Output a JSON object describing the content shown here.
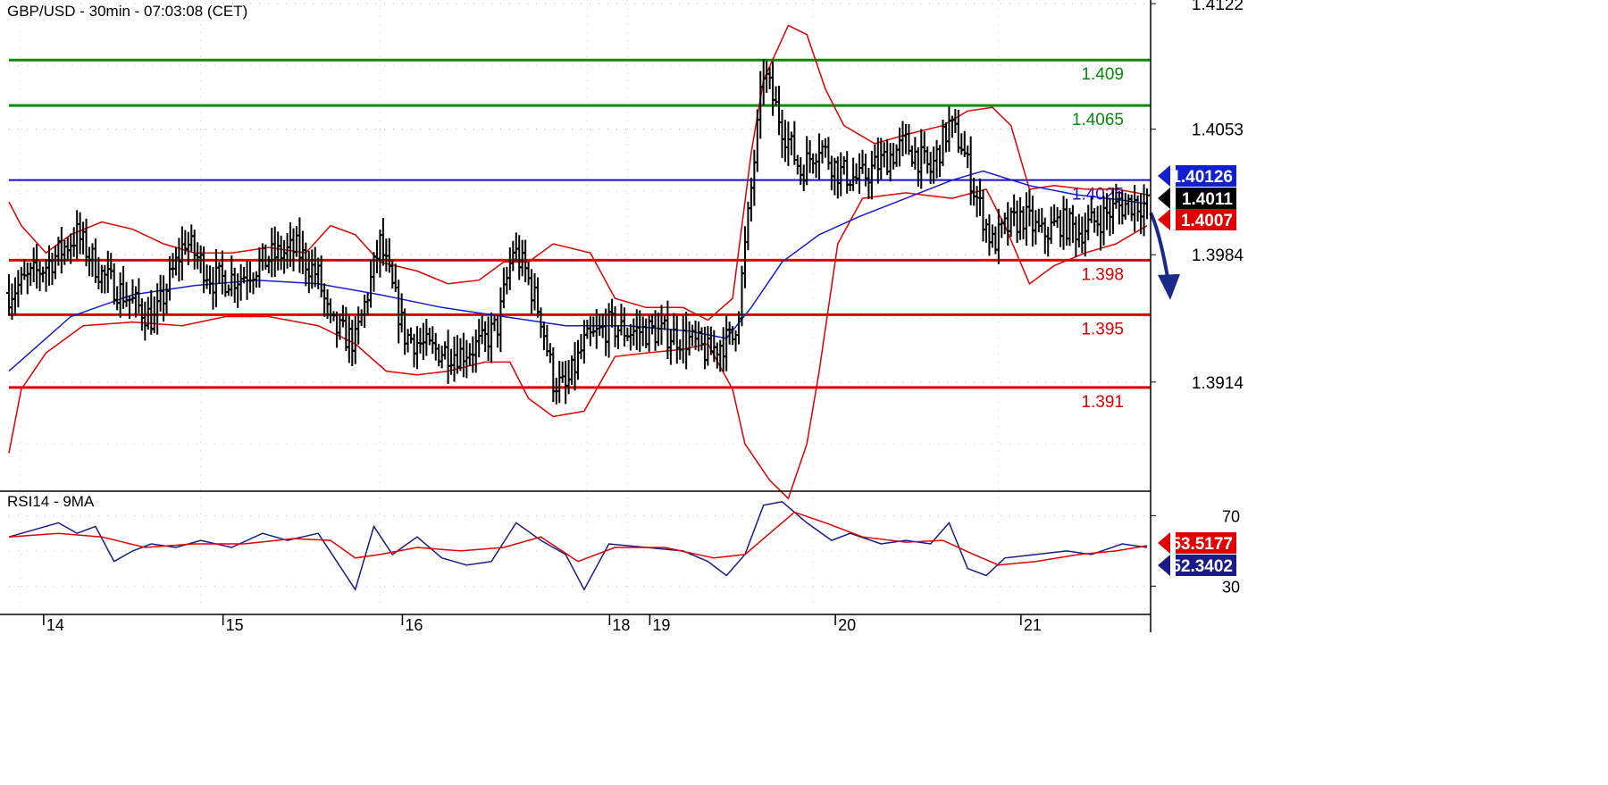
{
  "chart_data": [
    {
      "type": "candlestick",
      "title": "GBP/USD - 30min - 07:03:08 (CET)",
      "ylim": [
        1.3855,
        1.4124
      ],
      "y_ticks": [
        "1.4122",
        "1.4053",
        "1.3984",
        "1.3914"
      ],
      "x_ticks": [
        "14",
        "15",
        "16",
        "18",
        "19",
        "20",
        "21"
      ],
      "grid": true,
      "levels": [
        {
          "label": "1.409",
          "value": 1.4091,
          "color": "#0a8a0a"
        },
        {
          "label": "1.4065",
          "value": 1.4066,
          "color": "#0a8a0a"
        },
        {
          "label": "1.4025",
          "value": 1.4025,
          "color": "#1010c8"
        },
        {
          "label": "1.398",
          "value": 1.3981,
          "color": "#e00000"
        },
        {
          "label": "1.395",
          "value": 1.3951,
          "color": "#e00000"
        },
        {
          "label": "1.391",
          "value": 1.3911,
          "color": "#e00000"
        }
      ],
      "price_badges": [
        {
          "label": "1.40126",
          "value": 1.40126,
          "color": "#1020d0"
        },
        {
          "label": "1.4011",
          "value": 1.4011,
          "color": "#000000"
        },
        {
          "label": "1.4007",
          "value": 1.4007,
          "color": "#e00000"
        }
      ],
      "close_path": [
        [
          0,
          1.3963
        ],
        [
          12,
          1.3978
        ],
        [
          22,
          1.3995
        ],
        [
          30,
          1.3973
        ],
        [
          40,
          1.3958
        ],
        [
          47,
          1.3948
        ],
        [
          57,
          1.3992
        ],
        [
          66,
          1.397
        ],
        [
          75,
          1.3972
        ],
        [
          85,
          1.3983
        ],
        [
          93,
          1.3987
        ],
        [
          100,
          1.3972
        ],
        [
          104,
          1.3945
        ],
        [
          112,
          1.3936
        ],
        [
          120,
          1.399
        ],
        [
          128,
          1.394
        ],
        [
          136,
          1.3932
        ],
        [
          146,
          1.393
        ],
        [
          153,
          1.3935
        ],
        [
          158,
          1.3945
        ],
        [
          163,
          1.3987
        ],
        [
          167,
          1.3975
        ],
        [
          172,
          1.395
        ],
        [
          176,
          1.3915
        ],
        [
          180,
          1.391
        ],
        [
          186,
          1.3935
        ],
        [
          194,
          1.3945
        ],
        [
          200,
          1.3942
        ],
        [
          208,
          1.3942
        ],
        [
          214,
          1.394
        ],
        [
          220,
          1.3937
        ],
        [
          226,
          1.393
        ],
        [
          230,
          1.3935
        ],
        [
          234,
          1.3938
        ],
        [
          236,
          1.3955
        ],
        [
          240,
          1.402
        ],
        [
          244,
          1.4085
        ],
        [
          250,
          1.4055
        ],
        [
          256,
          1.403
        ],
        [
          262,
          1.4045
        ],
        [
          268,
          1.403
        ],
        [
          275,
          1.4025
        ],
        [
          282,
          1.4035
        ],
        [
          290,
          1.4045
        ],
        [
          298,
          1.403
        ],
        [
          304,
          1.4055
        ],
        [
          308,
          1.4045
        ],
        [
          312,
          1.402
        ],
        [
          318,
          1.399
        ],
        [
          322,
          1.3998
        ],
        [
          328,
          1.4005
        ],
        [
          334,
          1.3995
        ],
        [
          340,
          1.4002
        ],
        [
          346,
          1.3997
        ],
        [
          352,
          1.4003
        ],
        [
          358,
          1.401
        ],
        [
          364,
          1.4013
        ],
        [
          368,
          1.4011
        ]
      ],
      "sma_path": [
        [
          0,
          1.392
        ],
        [
          20,
          1.395
        ],
        [
          40,
          1.3962
        ],
        [
          60,
          1.3967
        ],
        [
          80,
          1.397
        ],
        [
          100,
          1.3968
        ],
        [
          120,
          1.3962
        ],
        [
          140,
          1.3955
        ],
        [
          160,
          1.395
        ],
        [
          180,
          1.3945
        ],
        [
          200,
          1.3945
        ],
        [
          220,
          1.3942
        ],
        [
          232,
          1.3938
        ],
        [
          240,
          1.3955
        ],
        [
          250,
          1.398
        ],
        [
          262,
          1.3995
        ],
        [
          275,
          1.4005
        ],
        [
          290,
          1.4015
        ],
        [
          305,
          1.4025
        ],
        [
          315,
          1.403
        ],
        [
          330,
          1.4022
        ],
        [
          345,
          1.4017
        ],
        [
          360,
          1.4014
        ],
        [
          368,
          1.4012
        ]
      ],
      "band_upper": [
        [
          0,
          1.4013
        ],
        [
          4,
          1.4
        ],
        [
          12,
          1.3985
        ],
        [
          20,
          1.3995
        ],
        [
          30,
          1.4002
        ],
        [
          40,
          1.3998
        ],
        [
          50,
          1.399
        ],
        [
          60,
          1.3985
        ],
        [
          72,
          1.3985
        ],
        [
          84,
          1.3988
        ],
        [
          96,
          1.3985
        ],
        [
          104,
          1.4
        ],
        [
          112,
          1.3995
        ],
        [
          120,
          1.398
        ],
        [
          132,
          1.3975
        ],
        [
          142,
          1.3968
        ],
        [
          152,
          1.397
        ],
        [
          160,
          1.398
        ],
        [
          168,
          1.398
        ],
        [
          176,
          1.399
        ],
        [
          188,
          1.3985
        ],
        [
          196,
          1.396
        ],
        [
          206,
          1.3955
        ],
        [
          218,
          1.3955
        ],
        [
          226,
          1.3948
        ],
        [
          234,
          1.396
        ],
        [
          240,
          1.404
        ],
        [
          244,
          1.408
        ],
        [
          252,
          1.411
        ],
        [
          258,
          1.4105
        ],
        [
          264,
          1.4075
        ],
        [
          270,
          1.4055
        ],
        [
          280,
          1.4045
        ],
        [
          290,
          1.405
        ],
        [
          302,
          1.4055
        ],
        [
          310,
          1.4063
        ],
        [
          318,
          1.4065
        ],
        [
          324,
          1.4055
        ],
        [
          330,
          1.402
        ],
        [
          338,
          1.4022
        ],
        [
          348,
          1.402
        ],
        [
          358,
          1.402
        ],
        [
          368,
          1.4017
        ]
      ],
      "band_lower": [
        [
          0,
          1.3875
        ],
        [
          4,
          1.391
        ],
        [
          12,
          1.393
        ],
        [
          24,
          1.3945
        ],
        [
          40,
          1.3947
        ],
        [
          56,
          1.3945
        ],
        [
          70,
          1.395
        ],
        [
          84,
          1.395
        ],
        [
          100,
          1.3945
        ],
        [
          112,
          1.3935
        ],
        [
          122,
          1.392
        ],
        [
          132,
          1.3918
        ],
        [
          142,
          1.392
        ],
        [
          154,
          1.3925
        ],
        [
          162,
          1.3925
        ],
        [
          168,
          1.3905
        ],
        [
          176,
          1.3895
        ],
        [
          186,
          1.3898
        ],
        [
          196,
          1.3928
        ],
        [
          206,
          1.393
        ],
        [
          218,
          1.3932
        ],
        [
          226,
          1.3935
        ],
        [
          234,
          1.391
        ],
        [
          238,
          1.388
        ],
        [
          246,
          1.386
        ],
        [
          252,
          1.385
        ],
        [
          258,
          1.388
        ],
        [
          262,
          1.392
        ],
        [
          268,
          1.399
        ],
        [
          276,
          1.4015
        ],
        [
          290,
          1.4018
        ],
        [
          305,
          1.4015
        ],
        [
          316,
          1.402
        ],
        [
          322,
          1.4
        ],
        [
          330,
          1.3968
        ],
        [
          338,
          1.3978
        ],
        [
          348,
          1.3985
        ],
        [
          358,
          1.399
        ],
        [
          368,
          1.4
        ]
      ]
    },
    {
      "type": "line",
      "title": "RSI14 - 9MA",
      "ylim": [
        20,
        85
      ],
      "y_ticks": [
        "70",
        "30"
      ],
      "grid": true,
      "price_badges": [
        {
          "label": "53.5177",
          "value": 53.5177,
          "color": "#e00000"
        },
        {
          "label": "52.3402",
          "value": 52.3402,
          "color": "#1a1a8a"
        }
      ],
      "series": [
        {
          "values": [
            [
              0,
              58
            ],
            [
              8,
              62
            ],
            [
              16,
              66
            ],
            [
              22,
              60
            ],
            [
              28,
              64
            ],
            [
              34,
              44
            ],
            [
              40,
              50
            ],
            [
              46,
              54
            ],
            [
              54,
              52
            ],
            [
              62,
              56
            ],
            [
              72,
              52
            ],
            [
              82,
              60
            ],
            [
              90,
              56
            ],
            [
              100,
              60
            ],
            [
              106,
              44
            ],
            [
              112,
              28
            ],
            [
              118,
              64
            ],
            [
              124,
              48
            ],
            [
              132,
              58
            ],
            [
              140,
              46
            ],
            [
              148,
              42
            ],
            [
              156,
              44
            ],
            [
              164,
              66
            ],
            [
              172,
              56
            ],
            [
              180,
              48
            ],
            [
              186,
              28
            ],
            [
              194,
              54
            ],
            [
              206,
              52
            ],
            [
              218,
              50
            ],
            [
              226,
              44
            ],
            [
              232,
              36
            ],
            [
              238,
              48
            ],
            [
              244,
              76
            ],
            [
              250,
              78
            ],
            [
              258,
              66
            ],
            [
              266,
              56
            ],
            [
              272,
              60
            ],
            [
              282,
              54
            ],
            [
              290,
              56
            ],
            [
              298,
              54
            ],
            [
              304,
              66
            ],
            [
              310,
              40
            ],
            [
              316,
              36
            ],
            [
              322,
              46
            ],
            [
              332,
              48
            ],
            [
              342,
              50
            ],
            [
              350,
              48
            ],
            [
              360,
              54
            ],
            [
              368,
              52
            ]
          ],
          "color": "#1a1a8a"
        },
        {
          "values": [
            [
              0,
              58
            ],
            [
              16,
              60
            ],
            [
              30,
              58
            ],
            [
              44,
              52
            ],
            [
              60,
              54
            ],
            [
              76,
              54
            ],
            [
              92,
              57
            ],
            [
              104,
              56
            ],
            [
              112,
              46
            ],
            [
              120,
              48
            ],
            [
              132,
              52
            ],
            [
              146,
              50
            ],
            [
              160,
              52
            ],
            [
              172,
              58
            ],
            [
              184,
              44
            ],
            [
              196,
              52
            ],
            [
              212,
              52
            ],
            [
              228,
              46
            ],
            [
              238,
              48
            ],
            [
              246,
              60
            ],
            [
              254,
              72
            ],
            [
              264,
              66
            ],
            [
              276,
              58
            ],
            [
              290,
              55
            ],
            [
              302,
              56
            ],
            [
              312,
              48
            ],
            [
              320,
              42
            ],
            [
              332,
              44
            ],
            [
              346,
              48
            ],
            [
              358,
              50
            ],
            [
              368,
              53
            ]
          ],
          "color": "#e00000"
        }
      ]
    }
  ]
}
